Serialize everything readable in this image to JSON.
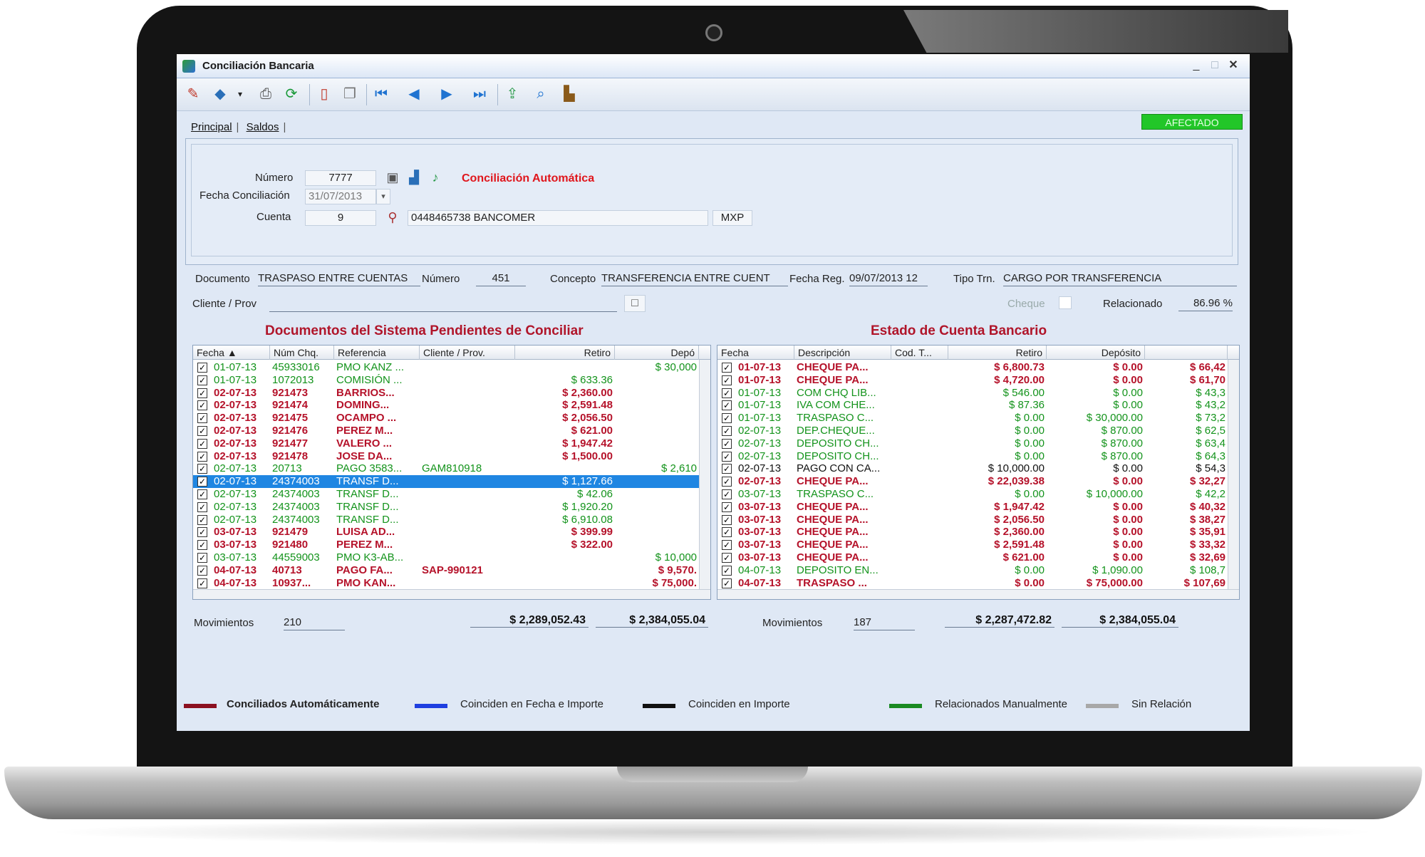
{
  "window": {
    "title": "Conciliación Bancaria"
  },
  "toolbar": {
    "status": "AFECTADO"
  },
  "tabs": [
    "Principal",
    "Saldos"
  ],
  "header": {
    "numero_label": "Número",
    "numero_value": "7777",
    "auto_label": "Conciliación Automática",
    "fecha_label": "Fecha Conciliación",
    "fecha_value": "31/07/2013",
    "cuenta_label": "Cuenta",
    "cuenta_value": "9",
    "cuenta_desc": "0448465738 BANCOMER",
    "moneda": "MXP"
  },
  "detail": {
    "documento_label": "Documento",
    "documento_value": "TRASPASO ENTRE CUENTAS",
    "numero_label": "Número",
    "numero_value": "451",
    "concepto_label": "Concepto",
    "concepto_value": "TRANSFERENCIA ENTRE CUENT",
    "fecha_reg_label": "Fecha Reg.",
    "fecha_reg_value": "09/07/2013 12",
    "tipo_trn_label": "Tipo Trn.",
    "tipo_trn_value": "CARGO POR TRANSFERENCIA",
    "cliente_label": "Cliente / Prov",
    "cliente_value": "",
    "cheque_label": "Cheque",
    "relacionado_label": "Relacionado",
    "relacionado_value": "86.96 %"
  },
  "colors": {
    "red": "#b5122a",
    "green": "#13931b",
    "black": "#111111",
    "blue": "#1f4fe0",
    "gray": "#a8a8a8",
    "selected": "#1f86e2"
  },
  "left_grid": {
    "title": "Documentos del Sistema Pendientes de Conciliar",
    "columns": [
      "Fecha",
      "Núm Chq.",
      "Referencia",
      "Cliente / Prov.",
      "Retiro",
      "Depó"
    ],
    "rows": [
      {
        "color": "green",
        "fecha": "01-07-13",
        "num": "45933016",
        "ref": "PMO KANZ ...",
        "cliente": "",
        "retiro": "",
        "deposito": "$ 30,000"
      },
      {
        "color": "green",
        "fecha": "01-07-13",
        "num": "1072013",
        "ref": "COMISIÓN ...",
        "cliente": "",
        "retiro": "$ 633.36",
        "deposito": ""
      },
      {
        "color": "red",
        "fecha": "02-07-13",
        "num": "921473",
        "ref": "BARRIOS...",
        "cliente": "",
        "retiro": "$ 2,360.00",
        "deposito": ""
      },
      {
        "color": "red",
        "fecha": "02-07-13",
        "num": "921474",
        "ref": "DOMING...",
        "cliente": "",
        "retiro": "$ 2,591.48",
        "deposito": ""
      },
      {
        "color": "red",
        "fecha": "02-07-13",
        "num": "921475",
        "ref": "OCAMPO ...",
        "cliente": "",
        "retiro": "$ 2,056.50",
        "deposito": ""
      },
      {
        "color": "red",
        "fecha": "02-07-13",
        "num": "921476",
        "ref": "PEREZ M...",
        "cliente": "",
        "retiro": "$ 621.00",
        "deposito": ""
      },
      {
        "color": "red",
        "fecha": "02-07-13",
        "num": "921477",
        "ref": "VALERO ...",
        "cliente": "",
        "retiro": "$ 1,947.42",
        "deposito": ""
      },
      {
        "color": "red",
        "fecha": "02-07-13",
        "num": "921478",
        "ref": "JOSE DA...",
        "cliente": "",
        "retiro": "$ 1,500.00",
        "deposito": ""
      },
      {
        "color": "green",
        "fecha": "02-07-13",
        "num": "20713",
        "ref": "PAGO 3583...",
        "cliente": "GAM810918",
        "retiro": "",
        "deposito": "$ 2,610"
      },
      {
        "color": "selected",
        "fecha": "02-07-13",
        "num": "24374003",
        "ref": "TRANSF D...",
        "cliente": "",
        "retiro": "$ 1,127.66",
        "deposito": ""
      },
      {
        "color": "green",
        "fecha": "02-07-13",
        "num": "24374003",
        "ref": "TRANSF D...",
        "cliente": "",
        "retiro": "$ 42.06",
        "deposito": ""
      },
      {
        "color": "green",
        "fecha": "02-07-13",
        "num": "24374003",
        "ref": "TRANSF D...",
        "cliente": "",
        "retiro": "$ 1,920.20",
        "deposito": ""
      },
      {
        "color": "green",
        "fecha": "02-07-13",
        "num": "24374003",
        "ref": "TRANSF D...",
        "cliente": "",
        "retiro": "$ 6,910.08",
        "deposito": ""
      },
      {
        "color": "red",
        "fecha": "03-07-13",
        "num": "921479",
        "ref": "LUISA AD...",
        "cliente": "",
        "retiro": "$ 399.99",
        "deposito": ""
      },
      {
        "color": "red",
        "fecha": "03-07-13",
        "num": "921480",
        "ref": "PEREZ M...",
        "cliente": "",
        "retiro": "$ 322.00",
        "deposito": ""
      },
      {
        "color": "green",
        "fecha": "03-07-13",
        "num": "44559003",
        "ref": "PMO K3-AB...",
        "cliente": "",
        "retiro": "",
        "deposito": "$ 10,000"
      },
      {
        "color": "red",
        "fecha": "04-07-13",
        "num": "40713",
        "ref": "PAGO FA...",
        "cliente": "SAP-990121",
        "retiro": "",
        "deposito": "$ 9,570."
      },
      {
        "color": "red",
        "fecha": "04-07-13",
        "num": "10937...",
        "ref": "PMO KAN...",
        "cliente": "",
        "retiro": "",
        "deposito": "$ 75,000."
      }
    ]
  },
  "right_grid": {
    "title": "Estado de Cuenta Bancario",
    "columns": [
      "Fecha",
      "Descripción",
      "Cod. T...",
      "Retiro",
      "Depósito"
    ],
    "rows": [
      {
        "color": "red",
        "fecha": "01-07-13",
        "desc": "CHEQUE PA...",
        "cod": "",
        "retiro": "$ 6,800.73",
        "deposito": "$ 0.00",
        "saldo": "$ 66,42"
      },
      {
        "color": "red",
        "fecha": "01-07-13",
        "desc": "CHEQUE PA...",
        "cod": "",
        "retiro": "$ 4,720.00",
        "deposito": "$ 0.00",
        "saldo": "$ 61,70"
      },
      {
        "color": "green",
        "fecha": "01-07-13",
        "desc": "COM CHQ LIB...",
        "cod": "",
        "retiro": "$ 546.00",
        "deposito": "$ 0.00",
        "saldo": "$ 43,3"
      },
      {
        "color": "green",
        "fecha": "01-07-13",
        "desc": "IVA COM CHE...",
        "cod": "",
        "retiro": "$ 87.36",
        "deposito": "$ 0.00",
        "saldo": "$ 43,2"
      },
      {
        "color": "green",
        "fecha": "01-07-13",
        "desc": "TRASPASO C...",
        "cod": "",
        "retiro": "$ 0.00",
        "deposito": "$ 30,000.00",
        "saldo": "$ 73,2"
      },
      {
        "color": "green",
        "fecha": "02-07-13",
        "desc": "DEP.CHEQUE...",
        "cod": "",
        "retiro": "$ 0.00",
        "deposito": "$ 870.00",
        "saldo": "$ 62,5"
      },
      {
        "color": "green",
        "fecha": "02-07-13",
        "desc": "DEPOSITO CH...",
        "cod": "",
        "retiro": "$ 0.00",
        "deposito": "$ 870.00",
        "saldo": "$ 63,4"
      },
      {
        "color": "green",
        "fecha": "02-07-13",
        "desc": "DEPOSITO CH...",
        "cod": "",
        "retiro": "$ 0.00",
        "deposito": "$ 870.00",
        "saldo": "$ 64,3"
      },
      {
        "color": "black",
        "fecha": "02-07-13",
        "desc": "PAGO CON CA...",
        "cod": "",
        "retiro": "$ 10,000.00",
        "deposito": "$ 0.00",
        "saldo": "$ 54,3"
      },
      {
        "color": "red",
        "fecha": "02-07-13",
        "desc": "CHEQUE PA...",
        "cod": "",
        "retiro": "$ 22,039.38",
        "deposito": "$ 0.00",
        "saldo": "$ 32,27"
      },
      {
        "color": "green",
        "fecha": "03-07-13",
        "desc": "TRASPASO C...",
        "cod": "",
        "retiro": "$ 0.00",
        "deposito": "$ 10,000.00",
        "saldo": "$ 42,2"
      },
      {
        "color": "red",
        "fecha": "03-07-13",
        "desc": "CHEQUE PA...",
        "cod": "",
        "retiro": "$ 1,947.42",
        "deposito": "$ 0.00",
        "saldo": "$ 40,32"
      },
      {
        "color": "red",
        "fecha": "03-07-13",
        "desc": "CHEQUE PA...",
        "cod": "",
        "retiro": "$ 2,056.50",
        "deposito": "$ 0.00",
        "saldo": "$ 38,27"
      },
      {
        "color": "red",
        "fecha": "03-07-13",
        "desc": "CHEQUE PA...",
        "cod": "",
        "retiro": "$ 2,360.00",
        "deposito": "$ 0.00",
        "saldo": "$ 35,91"
      },
      {
        "color": "red",
        "fecha": "03-07-13",
        "desc": "CHEQUE PA...",
        "cod": "",
        "retiro": "$ 2,591.48",
        "deposito": "$ 0.00",
        "saldo": "$ 33,32"
      },
      {
        "color": "red",
        "fecha": "03-07-13",
        "desc": "CHEQUE PA...",
        "cod": "",
        "retiro": "$ 621.00",
        "deposito": "$ 0.00",
        "saldo": "$ 32,69"
      },
      {
        "color": "green",
        "fecha": "04-07-13",
        "desc": "DEPOSITO EN...",
        "cod": "",
        "retiro": "$ 0.00",
        "deposito": "$ 1,090.00",
        "saldo": "$ 108,7"
      },
      {
        "color": "red",
        "fecha": "04-07-13",
        "desc": "TRASPASO ...",
        "cod": "",
        "retiro": "$ 0.00",
        "deposito": "$ 75,000.00",
        "saldo": "$ 107,69"
      }
    ]
  },
  "totals_left": {
    "movimientos_label": "Movimientos",
    "movimientos_value": "210",
    "retiro": "$ 2,289,052.43",
    "deposito": "$ 2,384,055.04"
  },
  "totals_right": {
    "movimientos_label": "Movimientos",
    "movimientos_value": "187",
    "retiro": "$ 2,287,472.82",
    "deposito": "$ 2,384,055.04"
  },
  "legend": [
    {
      "label": "Conciliados Automáticamente",
      "color": "#8b1020",
      "bold": true
    },
    {
      "label": "Coinciden en Fecha e Importe",
      "color": "#1f3fe0",
      "bold": false
    },
    {
      "label": "Coinciden en Importe",
      "color": "#111111",
      "bold": false
    },
    {
      "label": "Relacionados Manualmente",
      "color": "#1a8a22",
      "bold": false
    },
    {
      "label": "Sin Relación",
      "color": "#a8a8a8",
      "bold": false
    }
  ]
}
